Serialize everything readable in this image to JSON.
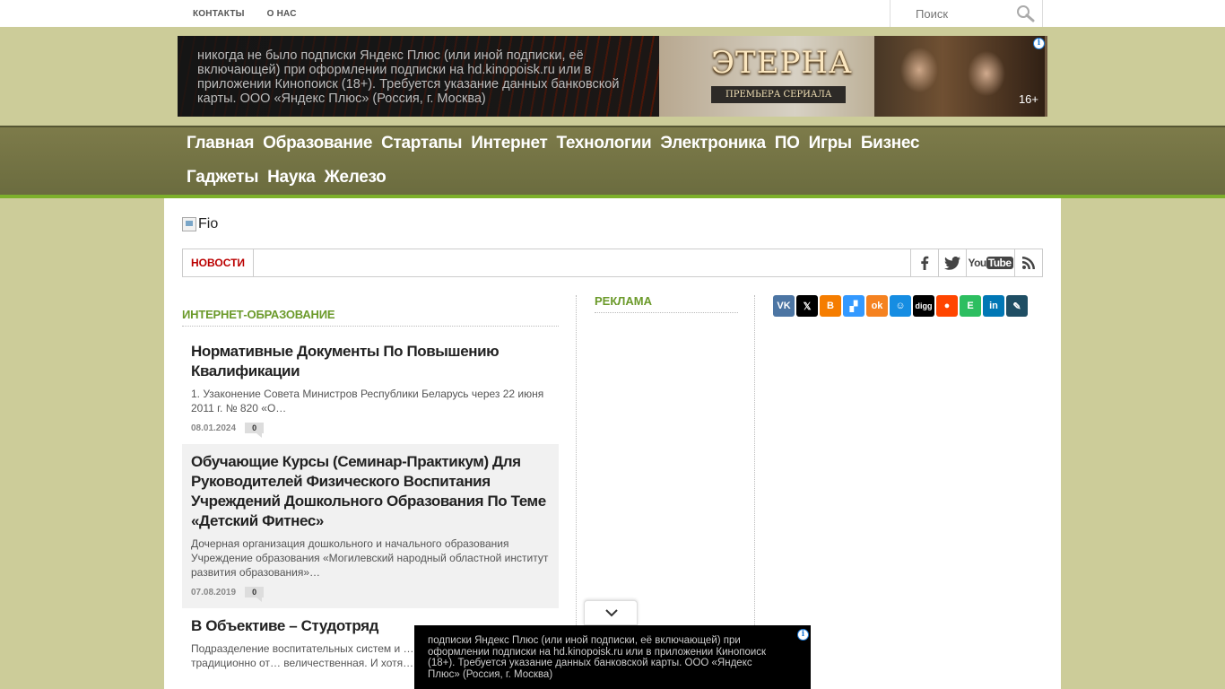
{
  "topnav": {
    "contacts": "КОНТАКТЫ",
    "about": "О НАС"
  },
  "search": {
    "placeholder": "Поиск"
  },
  "ad_top": {
    "text": "никогда не было подписки Яндекс Плюс (или иной подписки, её включающей) при оформлении подписки на hd.kinopoisk.ru или в приложении Кинопоиск (18+). Требуется указание данных банковской карты. ООО «Яндекс Плюс» (Россия, г. Москва)",
    "brand": "ЭТЕРНА",
    "tagline": "ПРЕМЬЕРА СЕРИАЛА",
    "age": "16+"
  },
  "mainnav": [
    "Главная",
    "Образование",
    "Стартапы",
    "Интернет",
    "Технологии",
    "Электроника",
    "ПО",
    "Игры",
    "Бизнес",
    "Гаджеты",
    "Наука",
    "Железо"
  ],
  "logo_alt": "Fio",
  "newsbar": {
    "label": "НОВОСТИ"
  },
  "section_title": "ИНТЕРНЕТ-ОБРАЗОВАНИЕ",
  "posts": [
    {
      "title": "Нормативные Документы По Повышению Квалификации",
      "excerpt": "1. Узаконение Совета Министров Республики Беларусь через 22 июня 2011 г. № 820 «О…",
      "date": "08.01.2024",
      "comments": "0"
    },
    {
      "title": "Обучающие Курсы (Семинар-Практикум) Для Руководителей Физического Воспитания Учреждений Дошкольного Образования По Теме «Детский Фитнес»",
      "excerpt": "Дочерная организация дошкольного и начального образования Учреждение образования «Могилевский народный областной институт развития образования»…",
      "date": "07.08.2019",
      "comments": "0"
    },
    {
      "title": "В Объективе – Студотряд",
      "excerpt": "Подразделение воспитательных систем и … Белорусских студотрядов традиционно от… величественная. И хотя…",
      "date": "",
      "comments": ""
    }
  ],
  "ad_column": {
    "title": "РЕКЛАМА"
  },
  "ad_bottom": {
    "text": "подписки Яндекс Плюс (или иной подписки, её включающей) при оформлении подписки на hd.kinopoisk.ru или в приложении Кинопоиск (18+). Требуется указание данных банковской карты. ООО «Яндекс Плюс» (Россия, г. Москва)"
  },
  "colors": {
    "background": "#cccc99",
    "nav": "#6b6c3f",
    "nav_border": "#7db02b",
    "accent_green": "#6b9a2a",
    "news_red": "#bb0000"
  }
}
